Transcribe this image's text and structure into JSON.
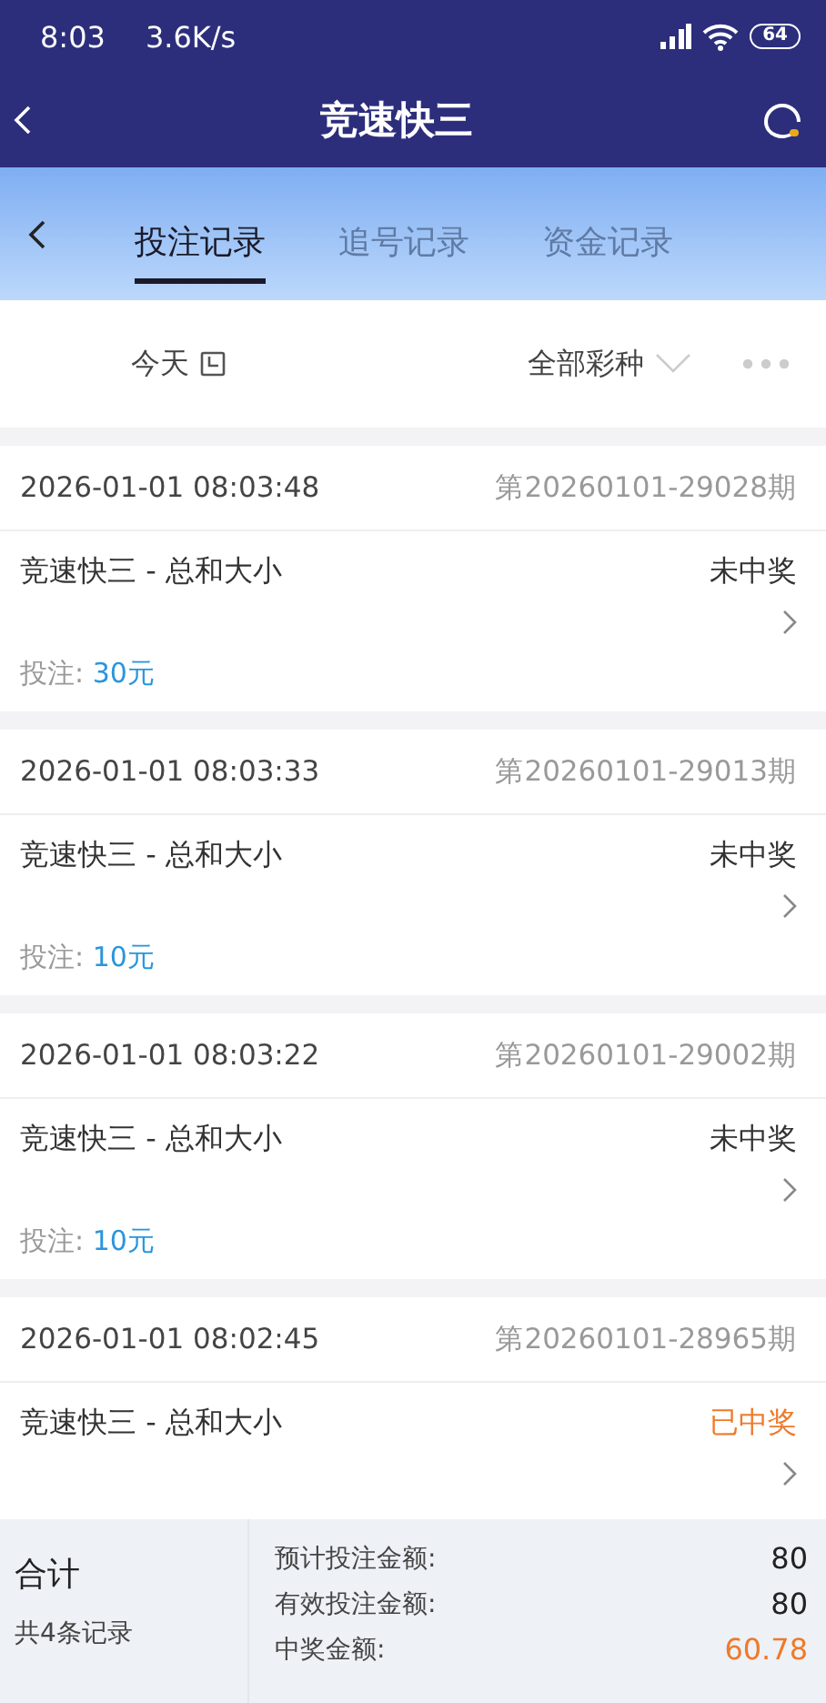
{
  "status_bar": {
    "time": "8:03",
    "speed": "3.6K/s",
    "battery": "64"
  },
  "header": {
    "title": "竞速快三"
  },
  "tabs": [
    {
      "label": "投注记录",
      "selected": true
    },
    {
      "label": "追号记录",
      "selected": false
    },
    {
      "label": "资金记录",
      "selected": false
    }
  ],
  "filter": {
    "date": "今天",
    "lottery": "全部彩种"
  },
  "records": [
    {
      "time": "2026-01-01 08:03:48",
      "period": "第20260101-29028期",
      "name": "竞速快三 - 总和大小",
      "status": "未中奖",
      "won": false,
      "bet_label": "投注:",
      "bet": "30元"
    },
    {
      "time": "2026-01-01 08:03:33",
      "period": "第20260101-29013期",
      "name": "竞速快三 - 总和大小",
      "status": "未中奖",
      "won": false,
      "bet_label": "投注:",
      "bet": "10元"
    },
    {
      "time": "2026-01-01 08:03:22",
      "period": "第20260101-29002期",
      "name": "竞速快三 - 总和大小",
      "status": "未中奖",
      "won": false,
      "bet_label": "投注:",
      "bet": "10元"
    },
    {
      "time": "2026-01-01 08:02:45",
      "period": "第20260101-28965期",
      "name": "竞速快三 - 总和大小",
      "status": "已中奖",
      "won": true
    }
  ],
  "summary": {
    "title": "合计",
    "count": "共4条记录",
    "rows": [
      {
        "label": "预计投注金额:",
        "value": "80",
        "highlight": false
      },
      {
        "label": "有效投注金额:",
        "value": "80",
        "highlight": false
      },
      {
        "label": "中奖金额:",
        "value": "60.78",
        "highlight": true
      }
    ]
  }
}
